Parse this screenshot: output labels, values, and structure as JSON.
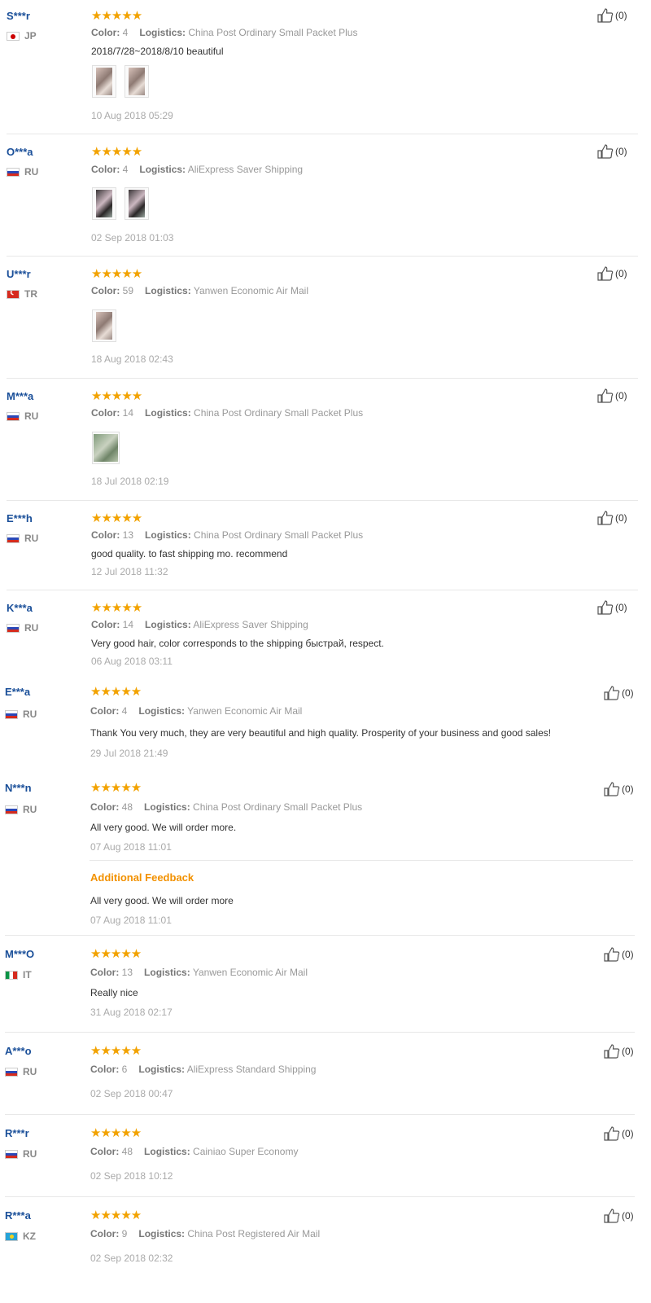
{
  "like_label": "(0)",
  "color_label": "Color:",
  "logistics_label": "Logistics:",
  "reviews": [
    {
      "user": "S***r",
      "country": "JP",
      "flag": "jp",
      "color": "4",
      "logistics": "China Post Ordinary Small Packet Plus",
      "text": "2018/7/28~2018/8/10 beautiful",
      "photos": 2,
      "date": "10 Aug 2018 05:29"
    },
    {
      "user": "O***a",
      "country": "RU",
      "flag": "ru",
      "color": "4",
      "logistics": "AliExpress Saver Shipping",
      "text": "",
      "photos": 2,
      "date": "02 Sep 2018 01:03"
    },
    {
      "user": "U***r",
      "country": "TR",
      "flag": "tr",
      "color": "59",
      "logistics": "Yanwen Economic Air Mail",
      "text": "",
      "photos": 1,
      "date": "18 Aug 2018 02:43"
    },
    {
      "user": "M***a",
      "country": "RU",
      "flag": "ru",
      "color": "14",
      "logistics": "China Post Ordinary Small Packet Plus",
      "text": "",
      "photos": 1,
      "date": "18 Jul 2018 02:19"
    },
    {
      "user": "E***h",
      "country": "RU",
      "flag": "ru",
      "color": "13",
      "logistics": "China Post Ordinary Small Packet Plus",
      "text": "good quality. to fast shipping mo. recommend",
      "photos": 0,
      "date": "12 Jul 2018 11:32"
    },
    {
      "user": "K***a",
      "country": "RU",
      "flag": "ru",
      "color": "14",
      "logistics": "AliExpress Saver Shipping",
      "text": "Very good hair, color corresponds to the shipping быстрай, respect.",
      "photos": 0,
      "date": "06 Aug 2018 03:11"
    },
    {
      "user": "E***a",
      "country": "RU",
      "flag": "ru",
      "color": "4",
      "logistics": "Yanwen Economic Air Mail",
      "text": "Thank You very much, they are very beautiful and high quality. Prosperity of your business and good sales!",
      "photos": 0,
      "date": "29 Jul 2018 21:49"
    },
    {
      "user": "N***n",
      "country": "RU",
      "flag": "ru",
      "color": "48",
      "logistics": "China Post Ordinary Small Packet Plus",
      "text": "All very good. We will order more.",
      "photos": 0,
      "date": "07 Aug 2018 11:01",
      "additional": {
        "title": "Additional Feedback",
        "text": "All very good. We will order more",
        "date": "07 Aug 2018 11:01"
      }
    },
    {
      "user": "M***O",
      "country": "IT",
      "flag": "it",
      "color": "13",
      "logistics": "Yanwen Economic Air Mail",
      "text": "Really nice",
      "photos": 0,
      "date": "31 Aug 2018 02:17"
    },
    {
      "user": "A***o",
      "country": "RU",
      "flag": "ru",
      "color": "6",
      "logistics": "AliExpress Standard Shipping",
      "text": "",
      "photos": 0,
      "date": "02 Sep 2018 00:47"
    },
    {
      "user": "R***r",
      "country": "RU",
      "flag": "ru",
      "color": "48",
      "logistics": "Cainiao Super Economy",
      "text": "",
      "photos": 0,
      "date": "02 Sep 2018 10:12"
    },
    {
      "user": "R***a",
      "country": "KZ",
      "flag": "kz",
      "color": "9",
      "logistics": "China Post Registered Air Mail",
      "text": "",
      "photos": 0,
      "date": "02 Sep 2018 02:32"
    }
  ]
}
